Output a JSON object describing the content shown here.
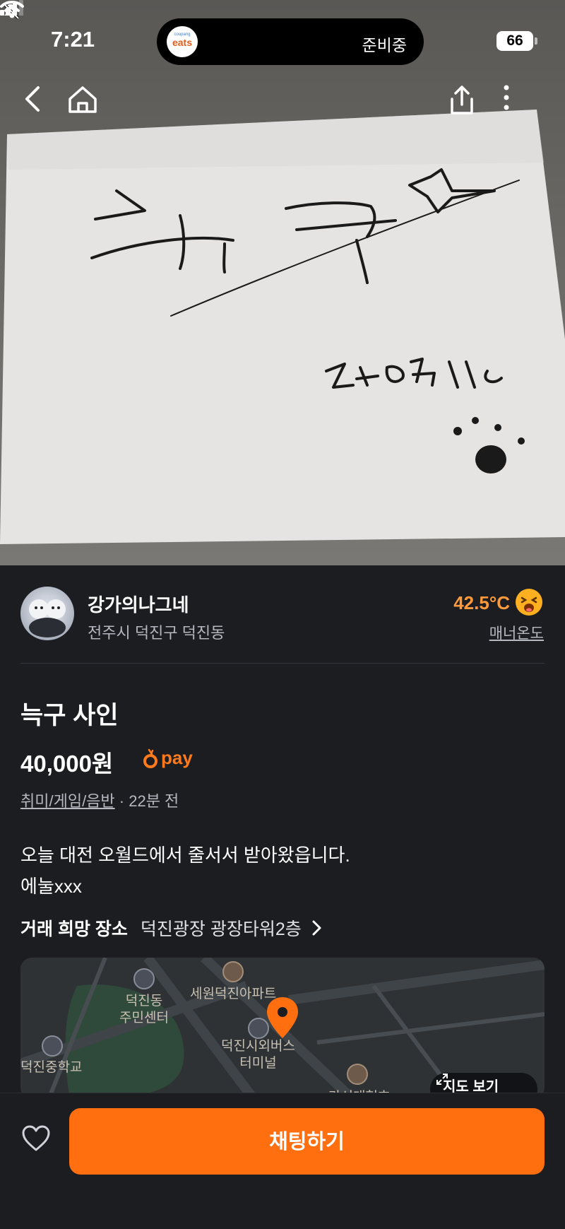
{
  "status_bar": {
    "time": "7:21",
    "island_app_logo_small": "coupang",
    "island_app_logo": "eats",
    "island_status": "준비중",
    "battery": "66"
  },
  "top_nav": {
    "back_icon": "chevron-left-icon",
    "home_icon": "home-icon",
    "share_icon": "share-icon",
    "more_icon": "more-vertical-icon"
  },
  "seller": {
    "name": "강가의나그네",
    "location": "전주시 덕진구 덕진동",
    "temperature": "42.5°C",
    "manner_label": "매너온도"
  },
  "listing": {
    "title": "늑구 사인",
    "price": "40,000원",
    "pay_label": "pay",
    "category": "취미/게임/음반",
    "time_ago": "· 22분 전",
    "description_line1": "오늘 대전 오월드에서 줄서서 받아왔읍니다.",
    "description_line2": "에눌xxx"
  },
  "meeting_place": {
    "label": "거래 희망 장소",
    "value": "덕진광장 광장타워2층"
  },
  "map": {
    "labels": {
      "community_center_1": "덕진동",
      "community_center_2": "주민센터",
      "apartment": "세원덕진아파트",
      "bus_terminal_1": "덕진시외버스",
      "bus_terminal_2": "터미널",
      "school": "덕진중학교",
      "partial_label": "라서대형호"
    },
    "view_button": "지도 보기"
  },
  "bottom_bar": {
    "chat_button": "채팅하기"
  },
  "colors": {
    "accent": "#ff6f0f",
    "temperature": "#ff9a3c",
    "background": "#1b1d21"
  }
}
